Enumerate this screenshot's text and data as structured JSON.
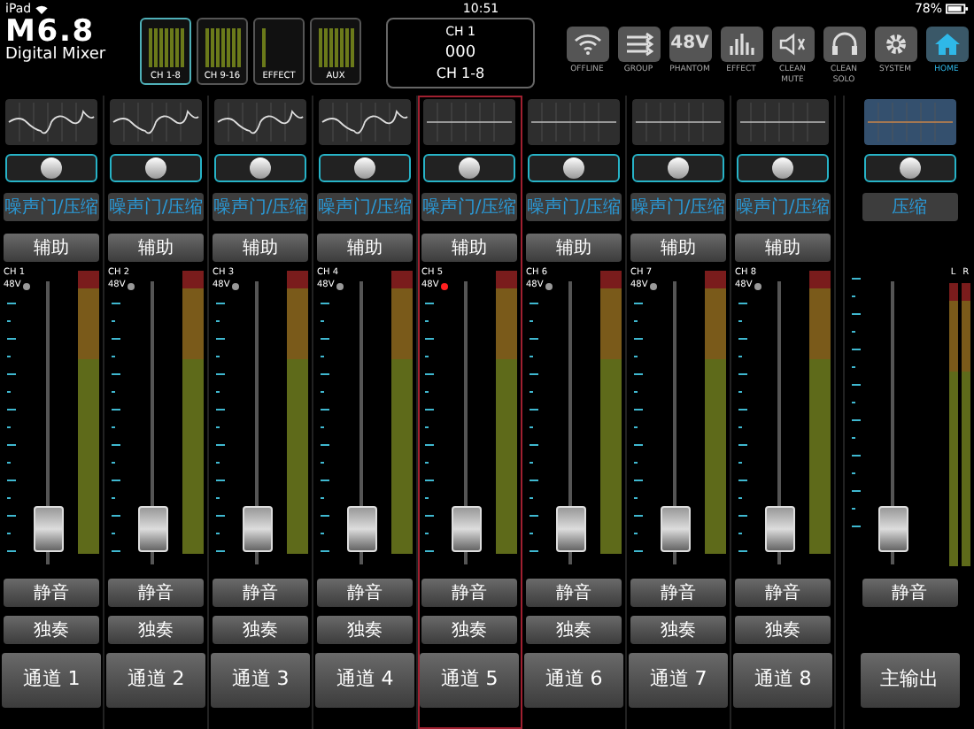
{
  "status_bar": {
    "device": "iPad",
    "time": "10:51",
    "battery": "78%"
  },
  "header": {
    "logo": "M6.8",
    "logo_subtitle": "Digital Mixer",
    "banks": [
      {
        "label": "CH 1-8",
        "selected": true
      },
      {
        "label": "CH 9-16",
        "selected": false
      },
      {
        "label": "EFFECT",
        "selected": false
      },
      {
        "label": "AUX",
        "selected": false
      }
    ],
    "display": [
      "CH 1",
      "000",
      "CH 1-8"
    ],
    "tools": [
      {
        "kind": "wifi",
        "label": "OFFLINE",
        "selected": false
      },
      {
        "kind": "group",
        "label": "GROUP",
        "selected": false
      },
      {
        "kind": "phantom",
        "icon_text": "48V",
        "label": "PHANTOM",
        "selected": false
      },
      {
        "kind": "effect",
        "label": "EFFECT",
        "selected": false
      },
      {
        "kind": "mute",
        "label": "CLEAN MUTE",
        "selected": false
      },
      {
        "kind": "solo",
        "label": "CLEAN SOLO",
        "selected": false
      },
      {
        "kind": "system",
        "label": "SYSTEM",
        "selected": false
      },
      {
        "kind": "home",
        "label": "HOME",
        "selected": true
      }
    ]
  },
  "channels": [
    {
      "kind": "input",
      "eq_curve": true,
      "dynamics": "噪声门/压缩",
      "aux": "辅助",
      "name_tag": "CH 1",
      "phantom_label": "48V",
      "phantom_on": false,
      "level": 0.05,
      "mute": "静音",
      "solo": "独奏",
      "name": "通道 1",
      "selected": false
    },
    {
      "kind": "input",
      "eq_curve": true,
      "dynamics": "噪声门/压缩",
      "aux": "辅助",
      "name_tag": "CH 2",
      "phantom_label": "48V",
      "phantom_on": false,
      "level": 0.05,
      "mute": "静音",
      "solo": "独奏",
      "name": "通道 2",
      "selected": false
    },
    {
      "kind": "input",
      "eq_curve": true,
      "dynamics": "噪声门/压缩",
      "aux": "辅助",
      "name_tag": "CH 3",
      "phantom_label": "48V",
      "phantom_on": false,
      "level": 0.05,
      "mute": "静音",
      "solo": "独奏",
      "name": "通道 3",
      "selected": false
    },
    {
      "kind": "input",
      "eq_curve": true,
      "dynamics": "噪声门/压缩",
      "aux": "辅助",
      "name_tag": "CH 4",
      "phantom_label": "48V",
      "phantom_on": false,
      "level": 0.05,
      "mute": "静音",
      "solo": "独奏",
      "name": "通道 4",
      "selected": false
    },
    {
      "kind": "input",
      "eq_curve": false,
      "dynamics": "噪声门/压缩",
      "aux": "辅助",
      "name_tag": "CH 5",
      "phantom_label": "48V",
      "phantom_on": true,
      "level": 0.05,
      "mute": "静音",
      "solo": "独奏",
      "name": "通道 5",
      "selected": true
    },
    {
      "kind": "input",
      "eq_curve": false,
      "dynamics": "噪声门/压缩",
      "aux": "辅助",
      "name_tag": "CH 6",
      "phantom_label": "48V",
      "phantom_on": false,
      "level": 0.05,
      "mute": "静音",
      "solo": "独奏",
      "name": "通道 6",
      "selected": false
    },
    {
      "kind": "input",
      "eq_curve": false,
      "dynamics": "噪声门/压缩",
      "aux": "辅助",
      "name_tag": "CH 7",
      "phantom_label": "48V",
      "phantom_on": false,
      "level": 0.05,
      "mute": "静音",
      "solo": "独奏",
      "name": "通道 7",
      "selected": false
    },
    {
      "kind": "input",
      "eq_curve": false,
      "dynamics": "噪声门/压缩",
      "aux": "辅助",
      "name_tag": "CH 8",
      "phantom_label": "48V",
      "phantom_on": false,
      "level": 0.05,
      "mute": "静音",
      "solo": "独奏",
      "name": "通道 8",
      "selected": false
    },
    {
      "kind": "master",
      "eq_curve": false,
      "dynamics": "压缩",
      "meter_labels": [
        "L",
        "R"
      ],
      "level": 0.05,
      "mute": "静音",
      "name": "主输出",
      "selected": false
    }
  ]
}
